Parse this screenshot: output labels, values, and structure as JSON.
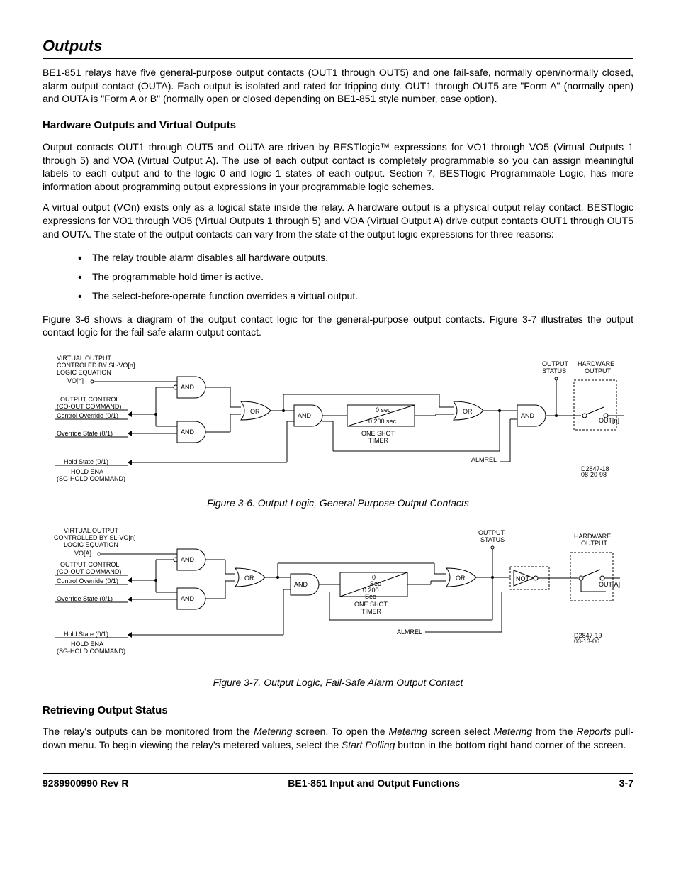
{
  "title": "Outputs",
  "intro": "BE1-851 relays have five general-purpose output contacts (OUT1 through OUT5) and one fail-safe, normally open/normally closed, alarm output contact (OUTA). Each output is isolated and rated for tripping duty. OUT1 through OUT5 are \"Form A\" (normally open) and OUTA is \"Form A or B\" (normally open or closed depending on BE1-851 style number, case option).",
  "h2a": "Hardware Outputs and Virtual Outputs",
  "p2": "Output contacts OUT1 through OUT5 and OUTA are driven by BESTlogic™ expressions for VO1 through VO5 (Virtual Outputs 1 through 5) and VOA (Virtual Output A). The use of each output contact is completely programmable so you can assign meaningful labels to each output and to the logic 0 and logic 1 states of each output. Section 7, BESTlogic Programmable Logic, has more information about programming output expressions in your programmable logic schemes.",
  "p3": "A virtual output (VOn) exists only as a logical state inside the relay. A hardware output is a physical output relay contact. BESTlogic expressions for VO1 through VO5 (Virtual Outputs 1 through 5) and VOA (Virtual Output A) drive output contacts OUT1 through OUT5 and OUTA. The state of the output contacts can vary from the state of the output logic expressions for three reasons:",
  "bullets": [
    "The relay trouble alarm disables all hardware outputs.",
    "The programmable hold timer is active.",
    "The select-before-operate function overrides a virtual output."
  ],
  "p4": "Figure 3-6 shows a diagram of the output contact logic for the general-purpose output contacts. Figure 3-7 illustrates the output contact logic for the fail-safe alarm output contact.",
  "fig1": {
    "caption": "Figure 3-6. Output Logic, General Purpose Output Contacts",
    "labels": {
      "vo_header1": "VIRTUAL OUTPUT",
      "vo_header2": "CONTROLED BY SL-VO[n]",
      "vo_header3": "LOGIC EQUATION",
      "vo_n": "VO[n]",
      "out_ctrl1": "OUTPUT CONTROL",
      "out_ctrl2": "(CO-OUT COMMAND)",
      "ctrl_override": "Control Override (0/1)",
      "override_state": "Override State (0/1)",
      "hold_state": "Hold State (0/1)",
      "hold_ena1": "HOLD ENA",
      "hold_ena2": "(SG-HOLD COMMAND)",
      "and": "AND",
      "or": "OR",
      "zero_sec": "0 sec",
      "p2_sec": "0.200 sec",
      "one_shot": "ONE SHOT",
      "timer": "TIMER",
      "almrel": "ALMREL",
      "out_status": "OUTPUT",
      "status": "STATUS",
      "hw_out": "HARDWARE",
      "output": "OUTPUT",
      "outn": "OUT[n]",
      "dnum": "D2847-18",
      "ddate": "08-20-98"
    }
  },
  "fig2": {
    "caption": "Figure 3-7. Output Logic, Fail-Safe Alarm Output Contact",
    "labels": {
      "vo_header1": "VIRTUAL OUTPUT",
      "vo_header2": "CONTROLLED BY SL-VO[n]",
      "vo_header3": "LOGIC EQUATION",
      "vo_a": "VO[A]",
      "out_ctrl1": "OUTPUT CONTROL",
      "out_ctrl2": "(CO-OUT COMMAND)",
      "ctrl_override": "Control Override (0/1)",
      "override_state": "Override State (0/1)",
      "hold_state": "Hold State (0/1)",
      "hold_ena1": "HOLD ENA",
      "hold_ena2": "(SG-HOLD COMMAND)",
      "and": "AND",
      "or": "OR",
      "zero": "0",
      "sec": "Sec",
      "p2": "0.200",
      "one_shot": "ONE SHOT",
      "timer": "TIMER",
      "almrel": "ALMREL",
      "out_status": "OUTPUT",
      "status": "STATUS",
      "not": "NOT",
      "hw_out": "HARDWARE",
      "output": "OUTPUT",
      "outa": "OUT[A]",
      "dnum": "D2847-19",
      "ddate": "03-13-06"
    }
  },
  "h2b": "Retrieving Output Status",
  "p5a": "The relay's outputs can be monitored from the ",
  "p5b": "Metering",
  "p5c": " screen. To open the ",
  "p5d": "Metering",
  "p5e": " screen select ",
  "p5f": "Metering",
  "p5g": " from the ",
  "p5h": "Reports",
  "p5i": " pull-down menu. To begin viewing the relay's metered values, select the ",
  "p5j": "Start Polling",
  "p5k": " button in the bottom right hand corner of the screen.",
  "footer": {
    "left": "9289900990 Rev R",
    "center": "BE1-851 Input and Output Functions",
    "right": "3-7"
  }
}
